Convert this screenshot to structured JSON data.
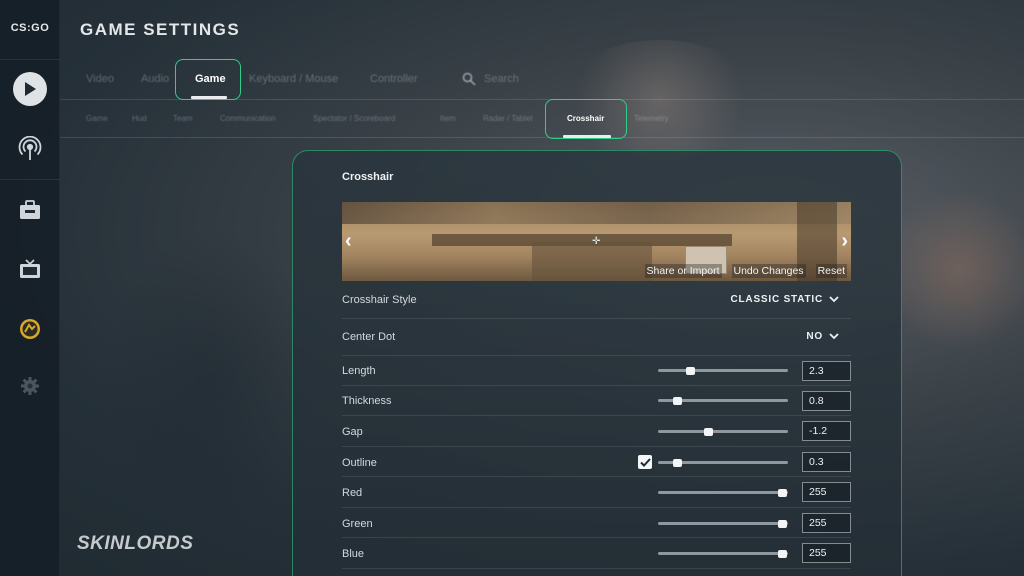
{
  "app": {
    "logo_text": "CS:GO",
    "page_title": "GAME SETTINGS"
  },
  "sidebar": {
    "items": [
      {
        "icon": "play-icon"
      },
      {
        "icon": "broadcast-icon"
      },
      {
        "icon": "briefcase-icon"
      },
      {
        "icon": "tv-icon"
      },
      {
        "icon": "badge-icon"
      },
      {
        "icon": "gear-icon"
      }
    ]
  },
  "top_tabs": [
    "Video",
    "Audio",
    "Game",
    "Keyboard / Mouse",
    "Controller",
    "Search"
  ],
  "top_tabs_active": "Game",
  "sub_tabs": [
    "Game",
    "Hud",
    "Team",
    "Communication",
    "Spectator / Scoreboard",
    "Item",
    "Radar / Tablet",
    "Crosshair",
    "Telemetry"
  ],
  "sub_tabs_active": "Crosshair",
  "panel": {
    "title": "Crosshair",
    "preview_actions": [
      "Share or Import",
      "Undo Changes",
      "Reset"
    ],
    "crosshair_style": {
      "label": "Crosshair Style",
      "value": "CLASSIC STATIC"
    },
    "center_dot": {
      "label": "Center Dot",
      "value": "NO"
    },
    "sliders": [
      {
        "label": "Length",
        "value": "2.3",
        "level": 0.25
      },
      {
        "label": "Thickness",
        "value": "0.8",
        "level": 0.15
      },
      {
        "label": "Gap",
        "value": "-1.2",
        "level": 0.39
      },
      {
        "label": "Outline",
        "value": "0.3",
        "level": 0.15,
        "checkbox": true
      },
      {
        "label": "Red",
        "value": "255",
        "level": 0.96
      },
      {
        "label": "Green",
        "value": "255",
        "level": 0.96
      },
      {
        "label": "Blue",
        "value": "255",
        "level": 0.96
      }
    ]
  },
  "watermark": "SKINLORDS",
  "colors": {
    "accent_outline": "#2fcf8a",
    "active_underline": "#e9ecef"
  }
}
